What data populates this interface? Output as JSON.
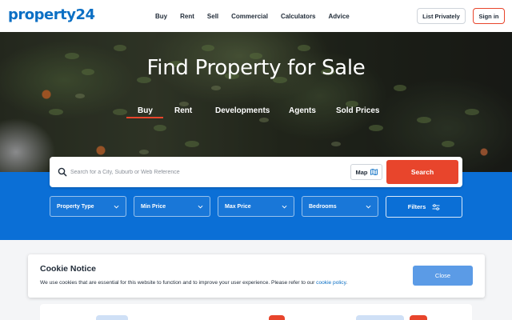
{
  "header": {
    "logo_text": "property",
    "logo_num": "24",
    "nav": [
      "Buy",
      "Rent",
      "Sell",
      "Commercial",
      "Calculators",
      "Advice"
    ],
    "list_privately": "List Privately",
    "sign_in": "Sign in"
  },
  "hero": {
    "title": "Find Property for Sale",
    "tabs": [
      "Buy",
      "Rent",
      "Developments",
      "Agents",
      "Sold Prices"
    ],
    "active_tab": "Buy"
  },
  "search": {
    "placeholder": "Search for a City, Suburb or Web Reference",
    "map_label": "Map",
    "search_label": "Search",
    "icon": "search-icon"
  },
  "filters": {
    "dropdowns": [
      "Property Type",
      "Min Price",
      "Max Price",
      "Bedrooms"
    ],
    "filters_label": "Filters"
  },
  "cookie": {
    "title": "Cookie Notice",
    "text": "We use cookies that are essential for this website to function and to improve your user experience. Please refer to our",
    "link": "cookie policy",
    "period": ".",
    "close_label": "Close"
  },
  "colors": {
    "brand_blue": "#0b6fc4",
    "band_blue": "#0b6fd6",
    "accent_red": "#e8452c",
    "close_blue": "#5b9be6"
  }
}
